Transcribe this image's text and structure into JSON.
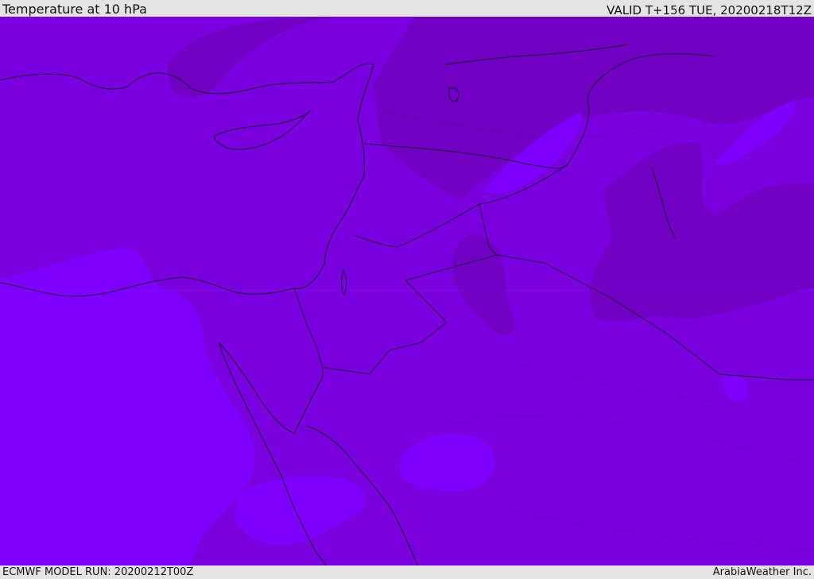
{
  "header": {
    "title": "Temperature at 10 hPa",
    "valid_time": "VALID T+156 TUE, 20200218T12Z"
  },
  "footer": {
    "model_run": "ECMWF MODEL RUN: 20200212T00Z",
    "credit": "ArabiaWeather Inc."
  },
  "map": {
    "variable": "temperature",
    "level": "10 hPa",
    "colors": {
      "band_cold": "#7100c4",
      "band_mid": "#7a00e0",
      "band_warm": "#7f00ff",
      "coastline": "#1a0030",
      "border": "#1a0030"
    }
  }
}
